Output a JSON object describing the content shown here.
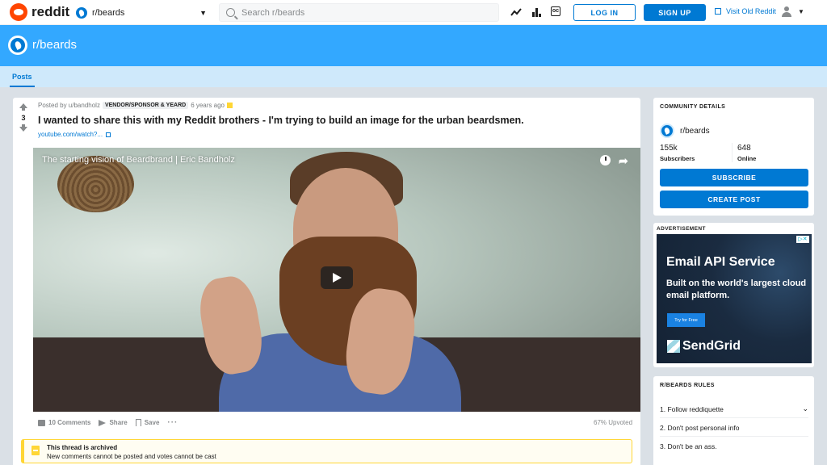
{
  "topnav": {
    "logo_text": "reddit",
    "subreddit_selector": "r/beards",
    "search_placeholder": "Search r/beards",
    "icons": [
      "trending-icon",
      "stats-icon",
      "chat-icon"
    ],
    "chat_icon_text": "oc",
    "login_label": "LOG IN",
    "signup_label": "SIGN UP",
    "old_reddit_label": "Visit Old Reddit"
  },
  "banner": {
    "title": "r/beards"
  },
  "tabs": [
    {
      "label": "Posts",
      "active": true
    }
  ],
  "post": {
    "vote_count": "3",
    "posted_by": "Posted by u/bandholz",
    "flair": "VENDOR/SPONSOR & YEARD",
    "age": "6 years ago",
    "title": "I wanted to share this with my Reddit brothers - I'm trying to build an image for the urban beardsmen.",
    "link_text": "youtube.com/watch?...",
    "video_title": "The starting vision of Beardbrand | Eric Bandholz",
    "actions": {
      "comments": "10 Comments",
      "share": "Share",
      "save": "Save",
      "more": "···"
    },
    "upvoted": "67% Upvoted",
    "archived_title": "This thread is archived",
    "archived_text": "New comments cannot be posted and votes cannot be cast"
  },
  "sidebar": {
    "community": {
      "heading": "COMMUNITY DETAILS",
      "name": "r/beards",
      "subscribers_value": "155k",
      "subscribers_label": "Subscribers",
      "online_value": "648",
      "online_label": "Online",
      "subscribe_label": "SUBSCRIBE",
      "create_post_label": "CREATE POST"
    },
    "ad": {
      "label": "ADVERTISEMENT",
      "headline": "Email API Service",
      "sub": "Built on the world's largest cloud email platform.",
      "cta": "Try for Free",
      "brand": "SendGrid",
      "close": "▷✕"
    },
    "rules": {
      "heading": "R/BEARDS RULES",
      "items": [
        "1. Follow reddiquette",
        "2. Don't post personal info",
        "3. Don't be an ass."
      ]
    }
  },
  "colors": {
    "brand": "#ff4500",
    "accent": "#0079d3",
    "banner": "#33a8ff",
    "tab_bar": "#cfe9fb",
    "archived": "#ffd635"
  }
}
